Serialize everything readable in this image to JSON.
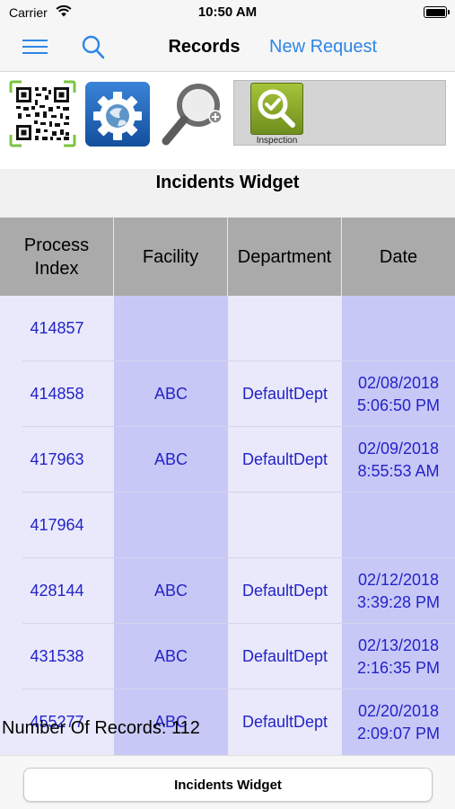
{
  "status_bar": {
    "carrier": "Carrier",
    "time": "10:50 AM"
  },
  "nav": {
    "title": "Records",
    "new_request_label": "New Request"
  },
  "icons": {
    "inspection_label": "Inspection"
  },
  "widget": {
    "title": "Incidents Widget"
  },
  "table": {
    "headers": [
      "Process Index",
      "Facility",
      "Department",
      "Date"
    ],
    "rows": [
      {
        "process_index": "414857",
        "facility": "",
        "department": "",
        "date": ""
      },
      {
        "process_index": "414858",
        "facility": "ABC",
        "department": "DefaultDept",
        "date": "02/08/2018 5:06:50 PM"
      },
      {
        "process_index": "417963",
        "facility": "ABC",
        "department": "DefaultDept",
        "date": "02/09/2018 8:55:53 AM"
      },
      {
        "process_index": "417964",
        "facility": "",
        "department": "",
        "date": ""
      },
      {
        "process_index": "428144",
        "facility": "ABC",
        "department": "DefaultDept",
        "date": "02/12/2018 3:39:28 PM"
      },
      {
        "process_index": "431538",
        "facility": "ABC",
        "department": "DefaultDept",
        "date": "02/13/2018 2:16:35 PM"
      },
      {
        "process_index": "455277",
        "facility": "ABC",
        "department": "DefaultDept",
        "date": "02/20/2018 2:09:07 PM"
      }
    ]
  },
  "footer": {
    "record_count": "Number Of Records: 112",
    "button_label": "Incidents Widget"
  },
  "colors": {
    "accent": "#2f86e6",
    "cell_text": "#2323c8",
    "header_bg": "#aaaaaa",
    "band_light": "#e9e9fb",
    "band_dark": "#c8c8f7"
  }
}
